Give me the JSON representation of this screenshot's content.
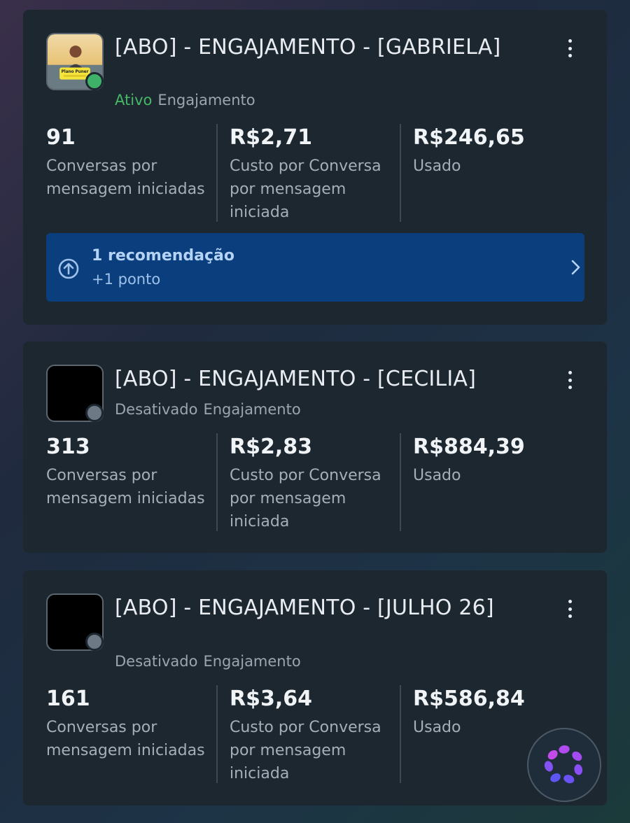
{
  "campaigns": [
    {
      "title": "[ABO] - ENGAJAMENTO - [GABRIELA]",
      "status": "Ativo",
      "objective": "Engajamento",
      "thumbnail": "photo-thumbnail",
      "metrics": [
        {
          "value": "91",
          "label": "Conversas por mensagem iniciadas"
        },
        {
          "value": "R$2,71",
          "label": "Custo por Conversa por mensagem iniciada"
        },
        {
          "value": "R$246,65",
          "label": "Usado"
        }
      ],
      "recommendation": {
        "title": "1 recomendação",
        "subtitle": "+1 ponto",
        "icon": "arrow-up-circle-icon"
      }
    },
    {
      "title": "[ABO] - ENGAJAMENTO - [CECILIA]",
      "status": "Desativado",
      "objective": "Engajamento",
      "thumbnail": "black-thumbnail",
      "metrics": [
        {
          "value": "313",
          "label": "Conversas por mensagem iniciadas"
        },
        {
          "value": "R$2,83",
          "label": "Custo por Conversa por mensagem iniciada"
        },
        {
          "value": "R$884,39",
          "label": "Usado"
        }
      ]
    },
    {
      "title": "[ABO] - ENGAJAMENTO - [JULHO 26]",
      "status": "Desativado",
      "objective": "Engajamento",
      "thumbnail": "black-thumbnail",
      "metrics": [
        {
          "value": "161",
          "label": "Conversas por mensagem iniciadas"
        },
        {
          "value": "R$3,64",
          "label": "Custo por Conversa por mensagem iniciada"
        },
        {
          "value": "R$586,84",
          "label": "Usado"
        }
      ]
    }
  ],
  "thumbnail_text": "Plano Puner",
  "colors": {
    "active": "#46b866",
    "inactive": "#6d7a86",
    "recommendation_bg": "#0a3e7d",
    "card_bg": "#1c2730"
  },
  "fab": {
    "icon": "meta-ai-icon"
  }
}
